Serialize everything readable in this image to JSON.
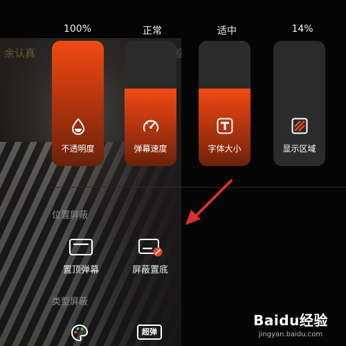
{
  "background": {
    "left_text": "余认真",
    "right_text": "莫差"
  },
  "sliders": [
    {
      "value_text": "100%",
      "label": "不透明度",
      "level": 1.0,
      "icon": "water-drop-icon"
    },
    {
      "value_text": "正常",
      "label": "弹幕速度",
      "level": 0.62,
      "icon": "speedometer-icon"
    },
    {
      "value_text": "适中",
      "label": "字体大小",
      "level": 0.62,
      "icon": "font-size-icon"
    },
    {
      "value_text": "14%",
      "label": "显示区域",
      "level": 0.0,
      "icon": "display-area-icon"
    }
  ],
  "position_block": {
    "title": "位置屏蔽",
    "options": [
      {
        "label": "置顶弹幕",
        "icon": "top-danmaku-icon"
      },
      {
        "label": "屏蔽置底",
        "icon": "bottom-danmaku-blocked-icon"
      }
    ]
  },
  "type_block": {
    "title": "类型屏蔽",
    "chaodan_badge": "超弹"
  },
  "watermark": {
    "logo": "Baidu经验",
    "url": "jingyan.baidu.com"
  },
  "colors": {
    "accent": "#f04a12",
    "card_bg": "#2b2b2b",
    "block_red": "#e8452c",
    "annotation_arrow": "#d7312b"
  }
}
